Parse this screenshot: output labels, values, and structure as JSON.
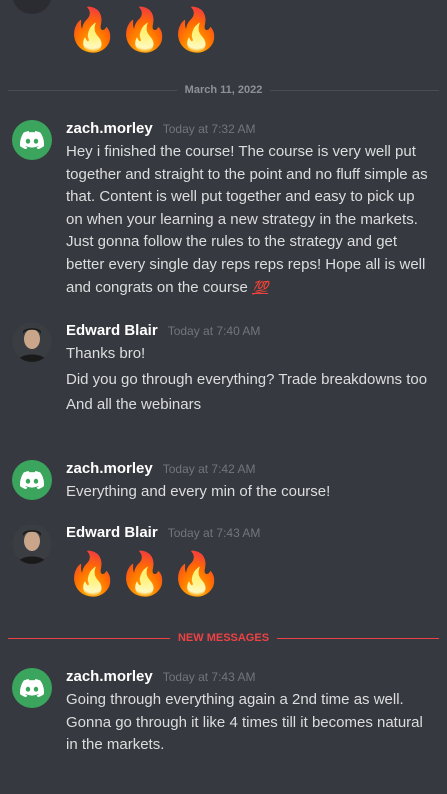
{
  "top_emojis": [
    "🔥",
    "🔥",
    "🔥"
  ],
  "date_divider": "March 11, 2022",
  "new_divider": "NEW MESSAGES",
  "messages": [
    {
      "username": "zach.morley",
      "timestamp": "Today at 7:32 AM",
      "avatar": "discord-logo-icon",
      "avatar_color": "#3ba55d",
      "lines": [
        "Hey i finished the course! The course is very well put together and straight to the point and no fluff simple as that. Content is well put together and easy to pick up on when your learning a new strategy in the markets. Just gonna follow the rules to the strategy and get better every single day reps reps reps! Hope all is well and congrats on the course"
      ],
      "trailing_emoji": "💯"
    },
    {
      "username": "Edward Blair",
      "timestamp": "Today at 7:40 AM",
      "avatar": "person-photo",
      "lines": [
        "Thanks bro!",
        "Did you go through everything? Trade breakdowns too",
        "And all the webinars"
      ]
    },
    {
      "username": "zach.morley",
      "timestamp": "Today at 7:42 AM",
      "avatar": "discord-logo-icon",
      "avatar_color": "#3ba55d",
      "lines": [
        "Everything and every min of the course!"
      ]
    },
    {
      "username": "Edward Blair",
      "timestamp": "Today at 7:43 AM",
      "avatar": "person-photo",
      "emojis": [
        "🔥",
        "🔥",
        "🔥"
      ]
    },
    {
      "username": "zach.morley",
      "timestamp": "Today at 7:43 AM",
      "avatar": "discord-logo-icon",
      "avatar_color": "#3ba55d",
      "lines": [
        "Going through everything again a 2nd time as well. Gonna go through it like 4 times till it becomes natural in the markets."
      ]
    }
  ]
}
